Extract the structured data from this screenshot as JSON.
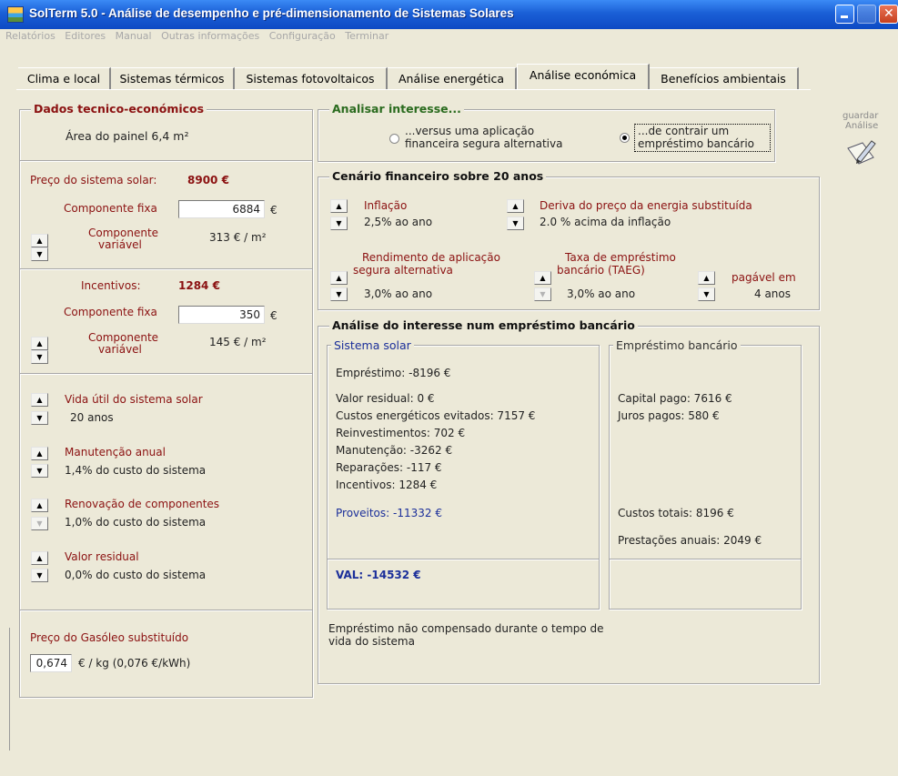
{
  "window": {
    "title": "SolTerm 5.0 - Análise de desempenho e pré-dimensionamento de Sistemas Solares"
  },
  "menu": [
    "Relatórios",
    "Editores",
    "Manual",
    "Outras informações",
    "Configuração",
    "Terminar"
  ],
  "tabs": [
    "Clima e local",
    "Sistemas térmicos",
    "Sistemas fotovoltaicos",
    "Análise energética",
    "Análise económica",
    "Benefícios ambientais"
  ],
  "active_tab": "Análise económica",
  "tech": {
    "title": "Dados tecnico-económicos",
    "area": "Área do painel 6,4 m²",
    "price_label": "Preço do sistema solar:",
    "price_value": "8900 €",
    "fixed_label": "Componente fixa",
    "fixed_value": "6884",
    "euro": "€",
    "variable_label_1": "Componente",
    "variable_label_2": "variável",
    "variable_value": "313 € / m²",
    "incentives_label": "Incentivos:",
    "incentives_value": "1284 €",
    "inc_fixed_label": "Componente fixa",
    "inc_fixed_value": "350",
    "inc_variable_label_1": "Componente",
    "inc_variable_label_2": "variável",
    "inc_variable_value": "145 € / m²",
    "life_label": "Vida útil do sistema solar",
    "life_value": "20 anos",
    "maint_label": "Manutenção anual",
    "maint_value": "1,4% do custo do sistema",
    "renew_label": "Renovação de componentes",
    "renew_value": "1,0% do custo do sistema",
    "residual_label": "Valor residual",
    "residual_value": "0,0% do custo do sistema",
    "fuel_label": "Preço do Gasóleo substituído",
    "fuel_value": "0,674",
    "fuel_unit": "€ / kg  (0,076 €/kWh)"
  },
  "interest": {
    "title": "Analisar interesse...",
    "opt1_line1": "...versus uma aplicação",
    "opt1_line2": "financeira segura alternativa",
    "opt2_line1": "...de contrair um",
    "opt2_line2": "empréstimo bancário",
    "selected": "opt2"
  },
  "save": {
    "line1": "guardar",
    "line2": "Análise"
  },
  "scenario": {
    "title": "Cenário financeiro sobre 20 anos",
    "inflation_label": "Inflação",
    "inflation_value": "2,5% ao ano",
    "energy_label": "Deriva do preço da energia substituída",
    "energy_value": "2.0 % acima da inflação",
    "return_label_1": "Rendimento de aplicação",
    "return_label_2": "segura alternativa",
    "return_value": "3,0% ao ano",
    "loan_rate_label_1": "Taxa de empréstimo",
    "loan_rate_label_2": "bancário (TAEG)",
    "loan_rate_value": "3,0% ao ano",
    "payable_label": "pagável em",
    "payable_value": "4 anos"
  },
  "analysis": {
    "title": "Análise do interesse num empréstimo bancário",
    "solar_title": "Sistema solar",
    "loan": "Empréstimo: -8196 €",
    "residual": "Valor residual: 0 €",
    "avoided": "Custos energéticos evitados: 7157 €",
    "reinvest": "Reinvestimentos: 702 €",
    "maint": "Manutenção: -3262 €",
    "repairs": "Reparações: -117 €",
    "incentives": "Incentivos: 1284 €",
    "profits": "Proveitos: -11332 €",
    "val": "VAL: -14532 €",
    "bank_title": "Empréstimo bancário",
    "capital": "Capital pago: 7616 €",
    "interest_paid": "Juros pagos: 580 €",
    "total_costs": "Custos totais: 8196 €",
    "annual": "Prestações anuais: 2049 €",
    "note_1": "Empréstimo não compensado durante o tempo de",
    "note_2": "vida do sistema"
  }
}
